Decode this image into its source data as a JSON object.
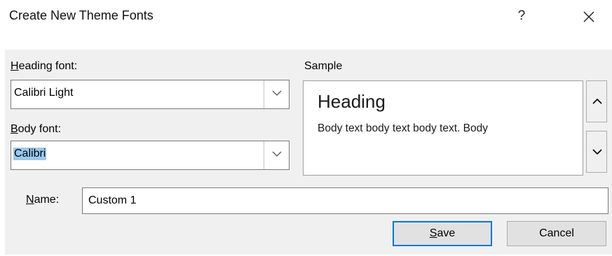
{
  "dialog": {
    "title": "Create New Theme Fonts",
    "help_label": "?"
  },
  "heading_font": {
    "label_mnemonic": "H",
    "label_rest": "eading font:",
    "value": "Calibri Light"
  },
  "body_font": {
    "label_mnemonic": "B",
    "label_rest": "ody font:",
    "value": "Calibri"
  },
  "sample": {
    "label": "Sample",
    "heading_text": "Heading",
    "body_text": "Body text body text body text. Body"
  },
  "name": {
    "label_mnemonic": "N",
    "label_rest": "ame:",
    "value": "Custom 1"
  },
  "buttons": {
    "save_mnemonic": "S",
    "save_rest": "ave",
    "cancel_label": "Cancel"
  },
  "icons": {
    "help": "question-mark-icon",
    "close": "close-icon",
    "dropdown": "chevron-down-icon",
    "scroll_up": "chevron-up-icon",
    "scroll_down": "chevron-down-icon"
  },
  "colors": {
    "focus_border": "#0078d7",
    "selection": "#99c9ef",
    "dialog_background": "#f0f0f0"
  }
}
